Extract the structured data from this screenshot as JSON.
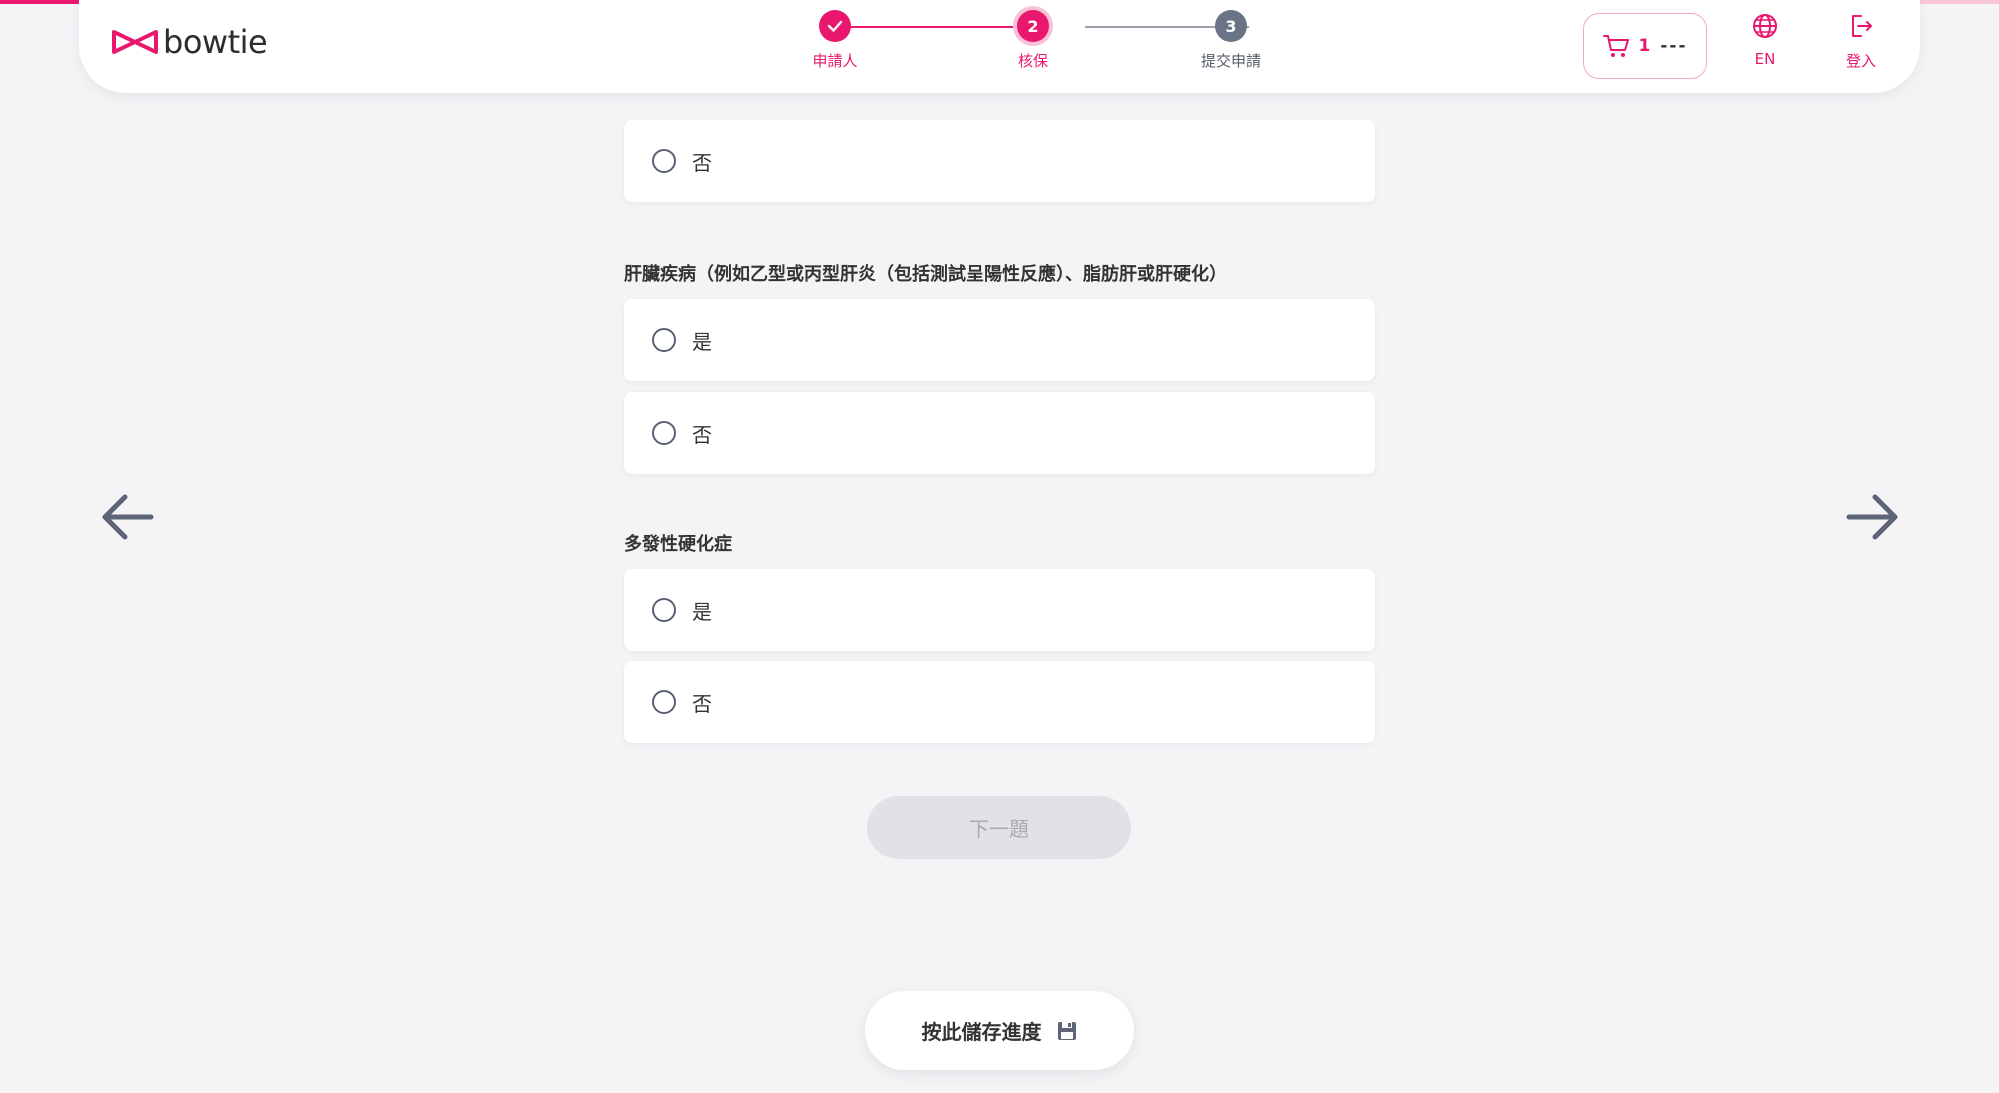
{
  "brand": {
    "name": "bowtie",
    "accent": "#e9176d"
  },
  "progress": {
    "fraction": 0.34
  },
  "stepper": {
    "steps": [
      {
        "label": "申請人",
        "state": "done"
      },
      {
        "label": "核保",
        "number": "2",
        "state": "active"
      },
      {
        "label": "提交申請",
        "number": "3",
        "state": "todo"
      }
    ]
  },
  "header": {
    "cart_count": "1",
    "cart_price": "---",
    "lang_label": "EN",
    "login_label": "登入"
  },
  "questions": {
    "prev_option_no": "否",
    "q1": {
      "text": "肝臟疾病（例如乙型或丙型肝炎（包括測試呈陽性反應）、脂肪肝或肝硬化）",
      "yes": "是",
      "no": "否"
    },
    "q2": {
      "text": "多發性硬化症",
      "yes": "是",
      "no": "否"
    }
  },
  "buttons": {
    "next_question": "下一題",
    "save_progress": "按此儲存進度"
  },
  "icons": {
    "cart": "cart-icon",
    "globe": "globe-icon",
    "logout": "logout-icon",
    "prev": "arrow-left-icon",
    "next": "arrow-right-icon",
    "save": "floppy-disk-icon",
    "check": "check-icon"
  }
}
